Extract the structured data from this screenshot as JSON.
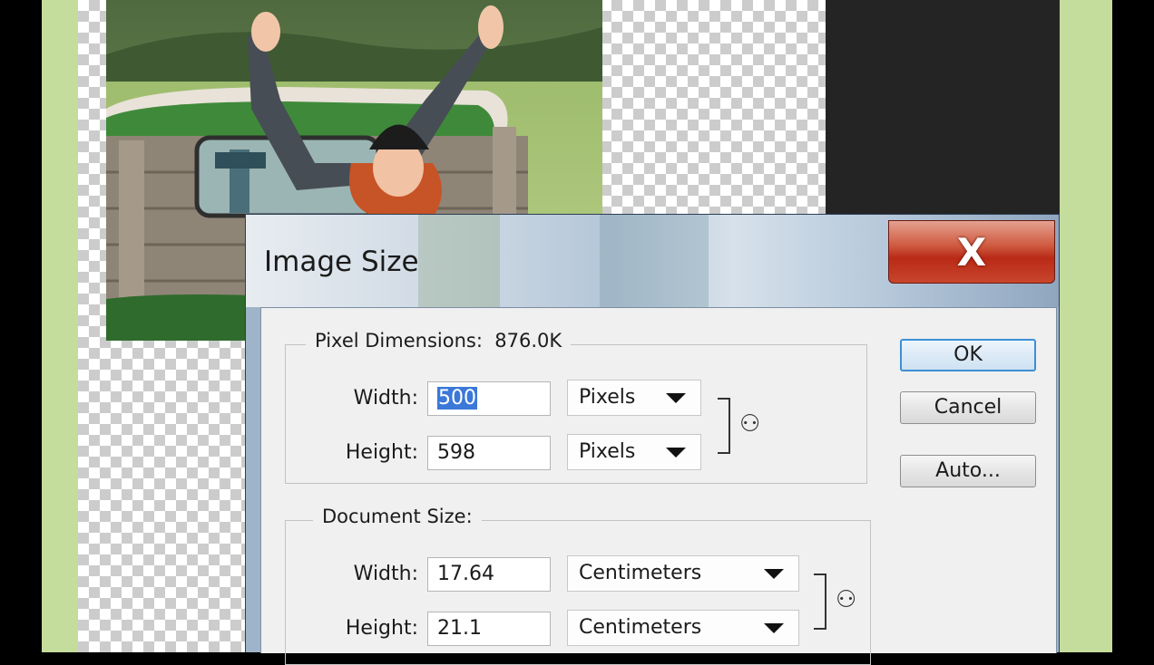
{
  "dialog": {
    "title": "Image Size",
    "close_glyph": "X",
    "pixel_dimensions": {
      "label": "Pixel Dimensions:",
      "size": "876.0K",
      "width_label": "Width:",
      "width_value": "500",
      "width_unit": "Pixels",
      "height_label": "Height:",
      "height_value": "598",
      "height_unit": "Pixels"
    },
    "document_size": {
      "label": "Document Size:",
      "width_label": "Width:",
      "width_value": "17.64",
      "width_unit": "Centimeters",
      "height_label": "Height:",
      "height_value": "21.1",
      "height_unit": "Centimeters"
    },
    "buttons": {
      "ok": "OK",
      "cancel": "Cancel",
      "auto": "Auto..."
    }
  },
  "icons": {
    "close": "close-icon",
    "link": "chain-link-icon",
    "dropdown": "triangle-down-icon"
  },
  "colors": {
    "selection": "#3b78d8",
    "close_button": "#b92a16",
    "default_button_border": "#3c8fd6",
    "frame_green": "#c4dd9c"
  }
}
